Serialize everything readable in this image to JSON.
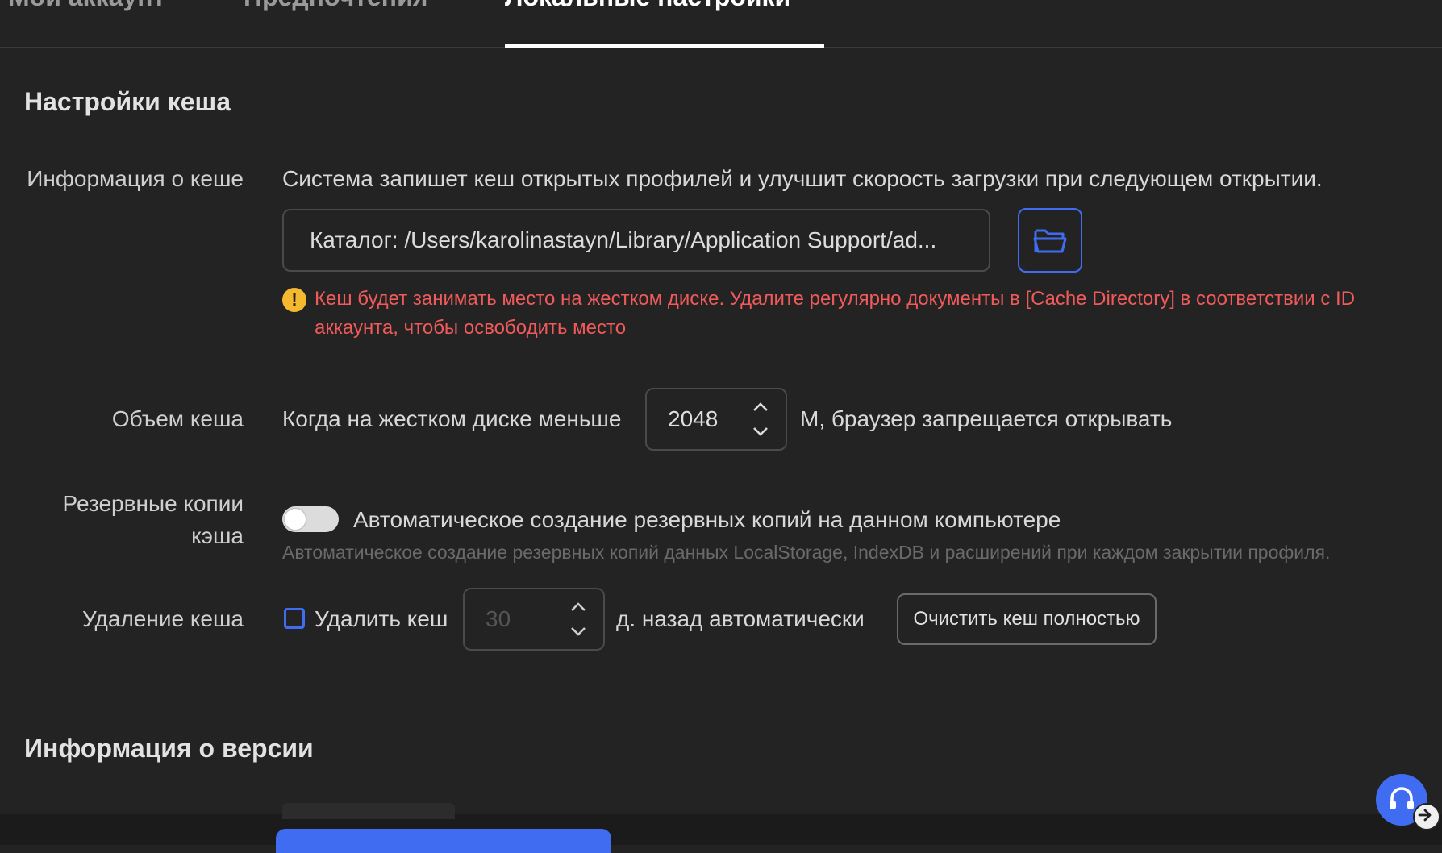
{
  "tabs": [
    "Мой аккаунт",
    "Предпочтения",
    "Локальные настройки"
  ],
  "cache_section": {
    "title": "Настройки кеша",
    "info": {
      "label": "Информация о кеше",
      "description": "Система запишет кеш открытых профилей и улучшит скорость загрузки при следующем открытии.",
      "path_value": "Каталог: /Users/karolinastayn/Library/Application Support/ad...",
      "folder_icon": "folder-open-icon",
      "warning_line1": "Кеш будет занимать место на жестком диске. Удалите регулярно документы в [Cache Directory] в соответствии с ID",
      "warning_line2": "аккаунта, чтобы освободить место"
    },
    "size": {
      "label": "Объем кеша",
      "prefix": "Когда на жестком диске меньше",
      "value": "2048",
      "suffix": "М, браузер запрещается открывать"
    },
    "backup": {
      "label_line1": "Резервные копии",
      "label_line2": "кэша",
      "toggle_label": "Автоматическое создание резервных копий на данном компьютере",
      "toggle_on": false,
      "hint": "Автоматическое создание резервных копий данных LocalStorage, IndexDB и расширений при каждом закрытии профиля."
    },
    "delete": {
      "label": "Удаление кеша",
      "checkbox_label": "Удалить кеш",
      "checked": false,
      "days_value": "30",
      "suffix": "д. назад автоматически",
      "clear_button": "Очистить кеш полностью"
    }
  },
  "version_section": {
    "title": "Информация о версии"
  },
  "colors": {
    "background": "#232323",
    "accent": "#3f6cf0",
    "warning_text": "#f05a5a",
    "warning_icon": "#f5b82e"
  }
}
